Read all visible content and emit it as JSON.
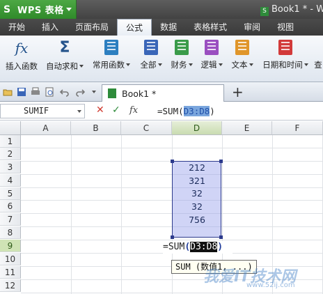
{
  "app": {
    "name": "WPS 表格",
    "doc_title": "Book1 * - W"
  },
  "menu": {
    "tabs": [
      "开始",
      "插入",
      "页面布局",
      "公式",
      "数据",
      "表格样式",
      "审阅",
      "视图"
    ],
    "active": "公式"
  },
  "ribbon": {
    "buttons": [
      {
        "label": "插入函数",
        "icon": "fx-icon",
        "has_dropdown": false
      },
      {
        "label": "自动求和",
        "icon": "sigma-icon",
        "has_dropdown": true
      },
      {
        "label": "常用函数",
        "icon": "book-icon",
        "has_dropdown": true,
        "color": "#2d7fc0"
      },
      {
        "label": "全部",
        "icon": "book-icon",
        "has_dropdown": true,
        "color": "#3a66b8"
      },
      {
        "label": "财务",
        "icon": "book-icon",
        "has_dropdown": true,
        "color": "#3a9b4a"
      },
      {
        "label": "逻辑",
        "icon": "book-icon",
        "has_dropdown": true,
        "color": "#9a4fc0"
      },
      {
        "label": "文本",
        "icon": "book-icon",
        "has_dropdown": true,
        "color": "#e0962b"
      },
      {
        "label": "日期和时间",
        "icon": "book-icon",
        "has_dropdown": true,
        "color": "#d23a3a"
      },
      {
        "label": "查",
        "icon": "",
        "has_dropdown": false
      }
    ]
  },
  "doc_tab": {
    "title": "Book1 *",
    "plus": "+"
  },
  "formula_bar": {
    "name_box": "SUMIF",
    "cancel": "✕",
    "confirm": "✓",
    "fx": "fx",
    "formula_prefix": "=SUM(",
    "formula_ref": "D3:D8",
    "formula_suffix": ")"
  },
  "grid": {
    "columns": [
      "A",
      "B",
      "C",
      "D",
      "E",
      "F"
    ],
    "selected_column": "D",
    "rows": [
      "1",
      "2",
      "3",
      "4",
      "5",
      "6",
      "7",
      "8",
      "9",
      "10",
      "11",
      "12"
    ],
    "selected_row": "9",
    "d_values": [
      "212",
      "321",
      "32",
      "32",
      "756"
    ],
    "edit_cell": {
      "prefix": "=SUM",
      "open": "(",
      "ref": "D3:D8",
      "close": ")"
    },
    "tooltip": "SUM (数值1, ...)"
  },
  "watermark": {
    "main": "我爱IT技术网",
    "sub": "www.52ij.com"
  },
  "colors": {
    "wps_green": "#3a9b34",
    "selection_blue": "#2c3a8c",
    "range_fill": "#aab0f0"
  }
}
